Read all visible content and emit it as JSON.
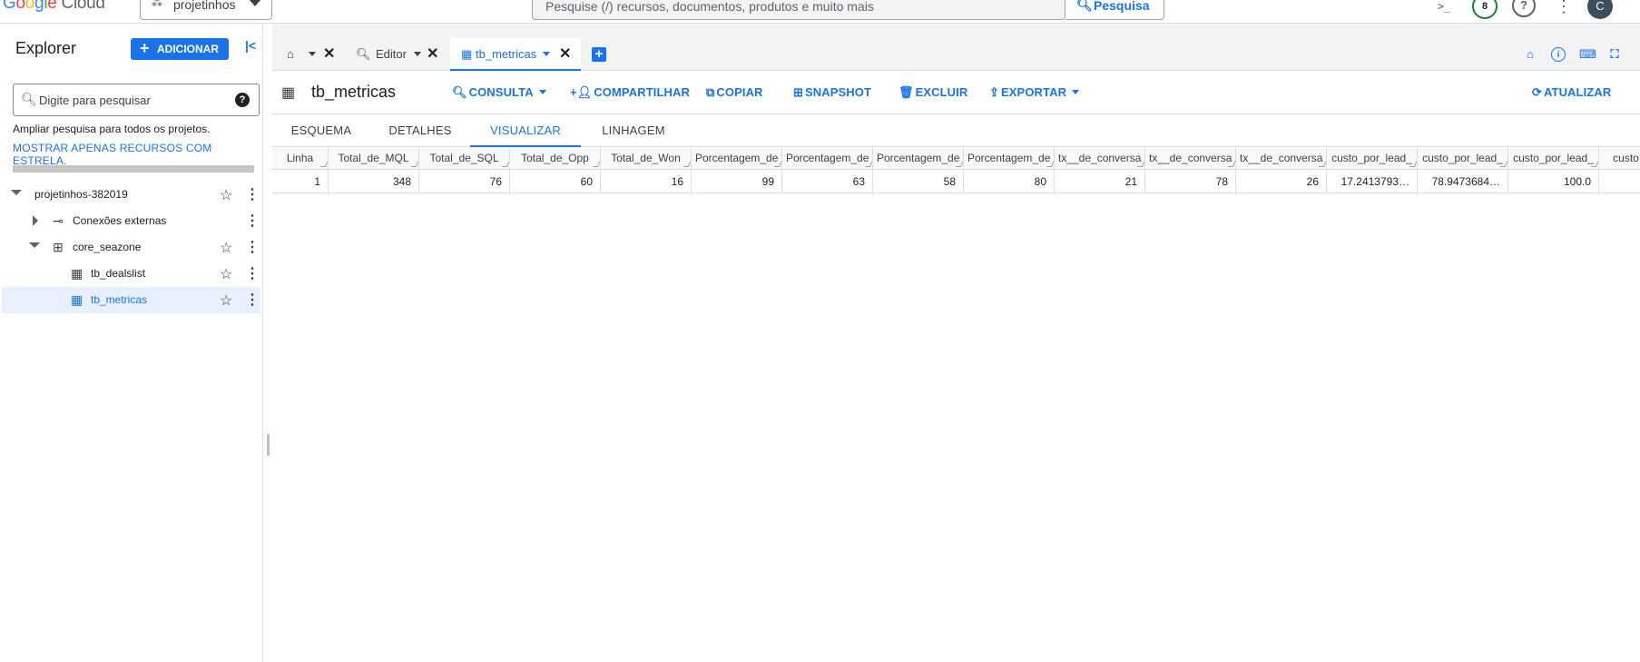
{
  "topbar": {
    "logo_g1": "G",
    "logo_g2": "o",
    "logo_g3": "o",
    "logo_g4": "g",
    "logo_g5": "l",
    "logo_g6": "e",
    "logo_cloud": "Cloud",
    "project_name": "projetinhos",
    "search_placeholder": "Pesquise (/) recursos, documentos, produtos e muito mais",
    "search_button": "Pesquisa",
    "notification_count": "8",
    "avatar_initial": "C"
  },
  "explorer": {
    "title": "Explorer",
    "add_label": "ADICIONAR",
    "search_placeholder": "Digite para pesquisar",
    "broaden_text": "Ampliar pesquisa para todos os projetos.",
    "starred_link": "MOSTRAR APENAS RECURSOS COM ESTRELA.",
    "tree": [
      {
        "label": "projetinhos-382019"
      },
      {
        "label": "Conexões externas"
      },
      {
        "label": "core_seazone"
      },
      {
        "label": "tb_dealslist"
      },
      {
        "label": "tb_metricas"
      }
    ]
  },
  "tabs": {
    "editor_label": "Editor",
    "table_label": "tb_metricas"
  },
  "toolbar": {
    "table_title": "tb_metricas",
    "consulta": "CONSULTA",
    "compartilhar": "COMPARTILHAR",
    "copiar": "COPIAR",
    "snapshot": "SNAPSHOT",
    "excluir": "EXCLUIR",
    "exportar": "EXPORTAR",
    "atualizar": "ATUALIZAR"
  },
  "subtabs": {
    "esquema": "ESQUEMA",
    "detalhes": "DETALHES",
    "visualizar": "VISUALIZAR",
    "linhagem": "LINHAGEM"
  },
  "grid": {
    "headers": [
      "Linha",
      "Total_de_MQL",
      "Total_de_SQL",
      "Total_de_Opp",
      "Total_de_Won",
      "Porcentagem_de",
      "Porcentagem_de",
      "Porcentagem_de",
      "Porcentagem_de",
      "tx__de_conversa",
      "tx__de_conversa",
      "tx__de_conversa",
      "custo_por_lead_",
      "custo_por_lead_",
      "custo_por_lead_",
      "custo"
    ],
    "rows": [
      [
        "1",
        "348",
        "76",
        "60",
        "16",
        "99",
        "63",
        "58",
        "80",
        "21",
        "78",
        "26",
        "17.2413793…",
        "78.9473684…",
        "100.0",
        ""
      ]
    ]
  },
  "colors": {
    "accent": "#1a73e8",
    "selected_row": "#e8f0fe",
    "notification_ring": "#188038"
  },
  "icons": {
    "terminal": "terminal-icon",
    "help": "help-icon",
    "more": "more-vert-icon",
    "home": "home-icon",
    "info": "info-icon",
    "keyboard": "keyboard-icon",
    "fullscreen": "fullscreen-icon"
  }
}
